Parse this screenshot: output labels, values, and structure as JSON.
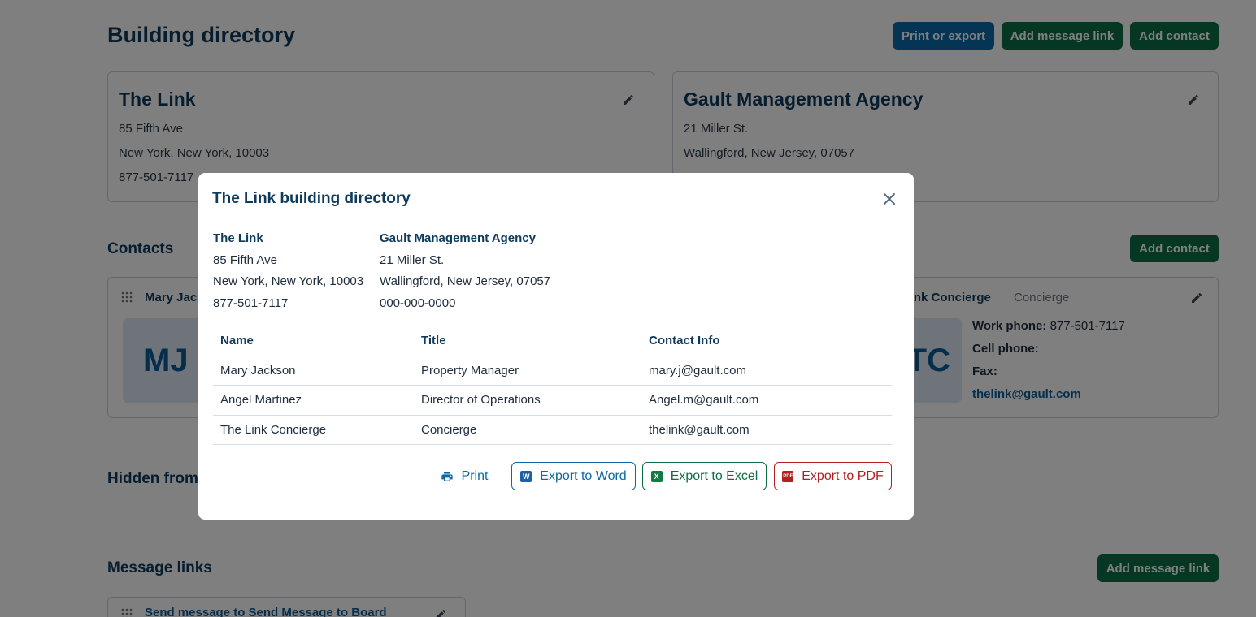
{
  "page": {
    "title": "Building directory",
    "buttons": {
      "print_export": "Print or export",
      "add_message_link": "Add message link",
      "add_contact": "Add contact"
    }
  },
  "building_card": {
    "name": "The Link",
    "address1": "85 Fifth Ave",
    "address2": "New York, New York, 10003",
    "phone": "877-501-7117"
  },
  "management_card": {
    "name": "Gault Management Agency",
    "address1": "21 Miller St.",
    "address2": "Wallingford, New Jersey, 07057"
  },
  "contacts_section": {
    "title": "Contacts",
    "add_contact": "Add contact",
    "card1": {
      "name_partial": "Mary Jack",
      "initials": "MJ"
    },
    "card2": {
      "name_partial": "e Link Concierge",
      "role": "Concierge",
      "initials": "TC",
      "work_phone_label": "Work phone:",
      "work_phone": "877-501-7117",
      "cell_phone_label": "Cell phone:",
      "fax_label": "Fax:",
      "email": "thelink@gault.com"
    }
  },
  "hidden_section": {
    "title_partial": "Hidden from re"
  },
  "message_links_section": {
    "title": "Message links",
    "add_button": "Add message link",
    "item_partial": "Send message to Send Message to Board"
  },
  "modal": {
    "title": "The Link building directory",
    "building": {
      "name": "The Link",
      "address1": "85 Fifth Ave",
      "address2": "New York, New York, 10003",
      "phone": "877-501-7117"
    },
    "management": {
      "name": "Gault Management Agency",
      "address1": "21 Miller St.",
      "address2": "Wallingford, New Jersey, 07057",
      "phone": "000-000-0000"
    },
    "table": {
      "headers": [
        "Name",
        "Title",
        "Contact Info"
      ],
      "rows": [
        [
          "Mary Jackson",
          "Property Manager",
          "mary.j@gault.com"
        ],
        [
          "Angel Martinez",
          "Director of Operations",
          "Angel.m@gault.com"
        ],
        [
          "The Link Concierge",
          "Concierge",
          "thelink@gault.com"
        ]
      ]
    },
    "actions": {
      "print": "Print",
      "word": "Export to Word",
      "excel": "Export to Excel",
      "pdf": "Export to PDF"
    },
    "icons": {
      "word": "W",
      "excel": "X",
      "pdf": "PDF"
    }
  },
  "colors": {
    "primary_blue": "#0d68a8",
    "primary_green": "#0d6e44",
    "pdf_red": "#b51f1f",
    "overlay": "rgba(0,0,0,0.5)"
  }
}
